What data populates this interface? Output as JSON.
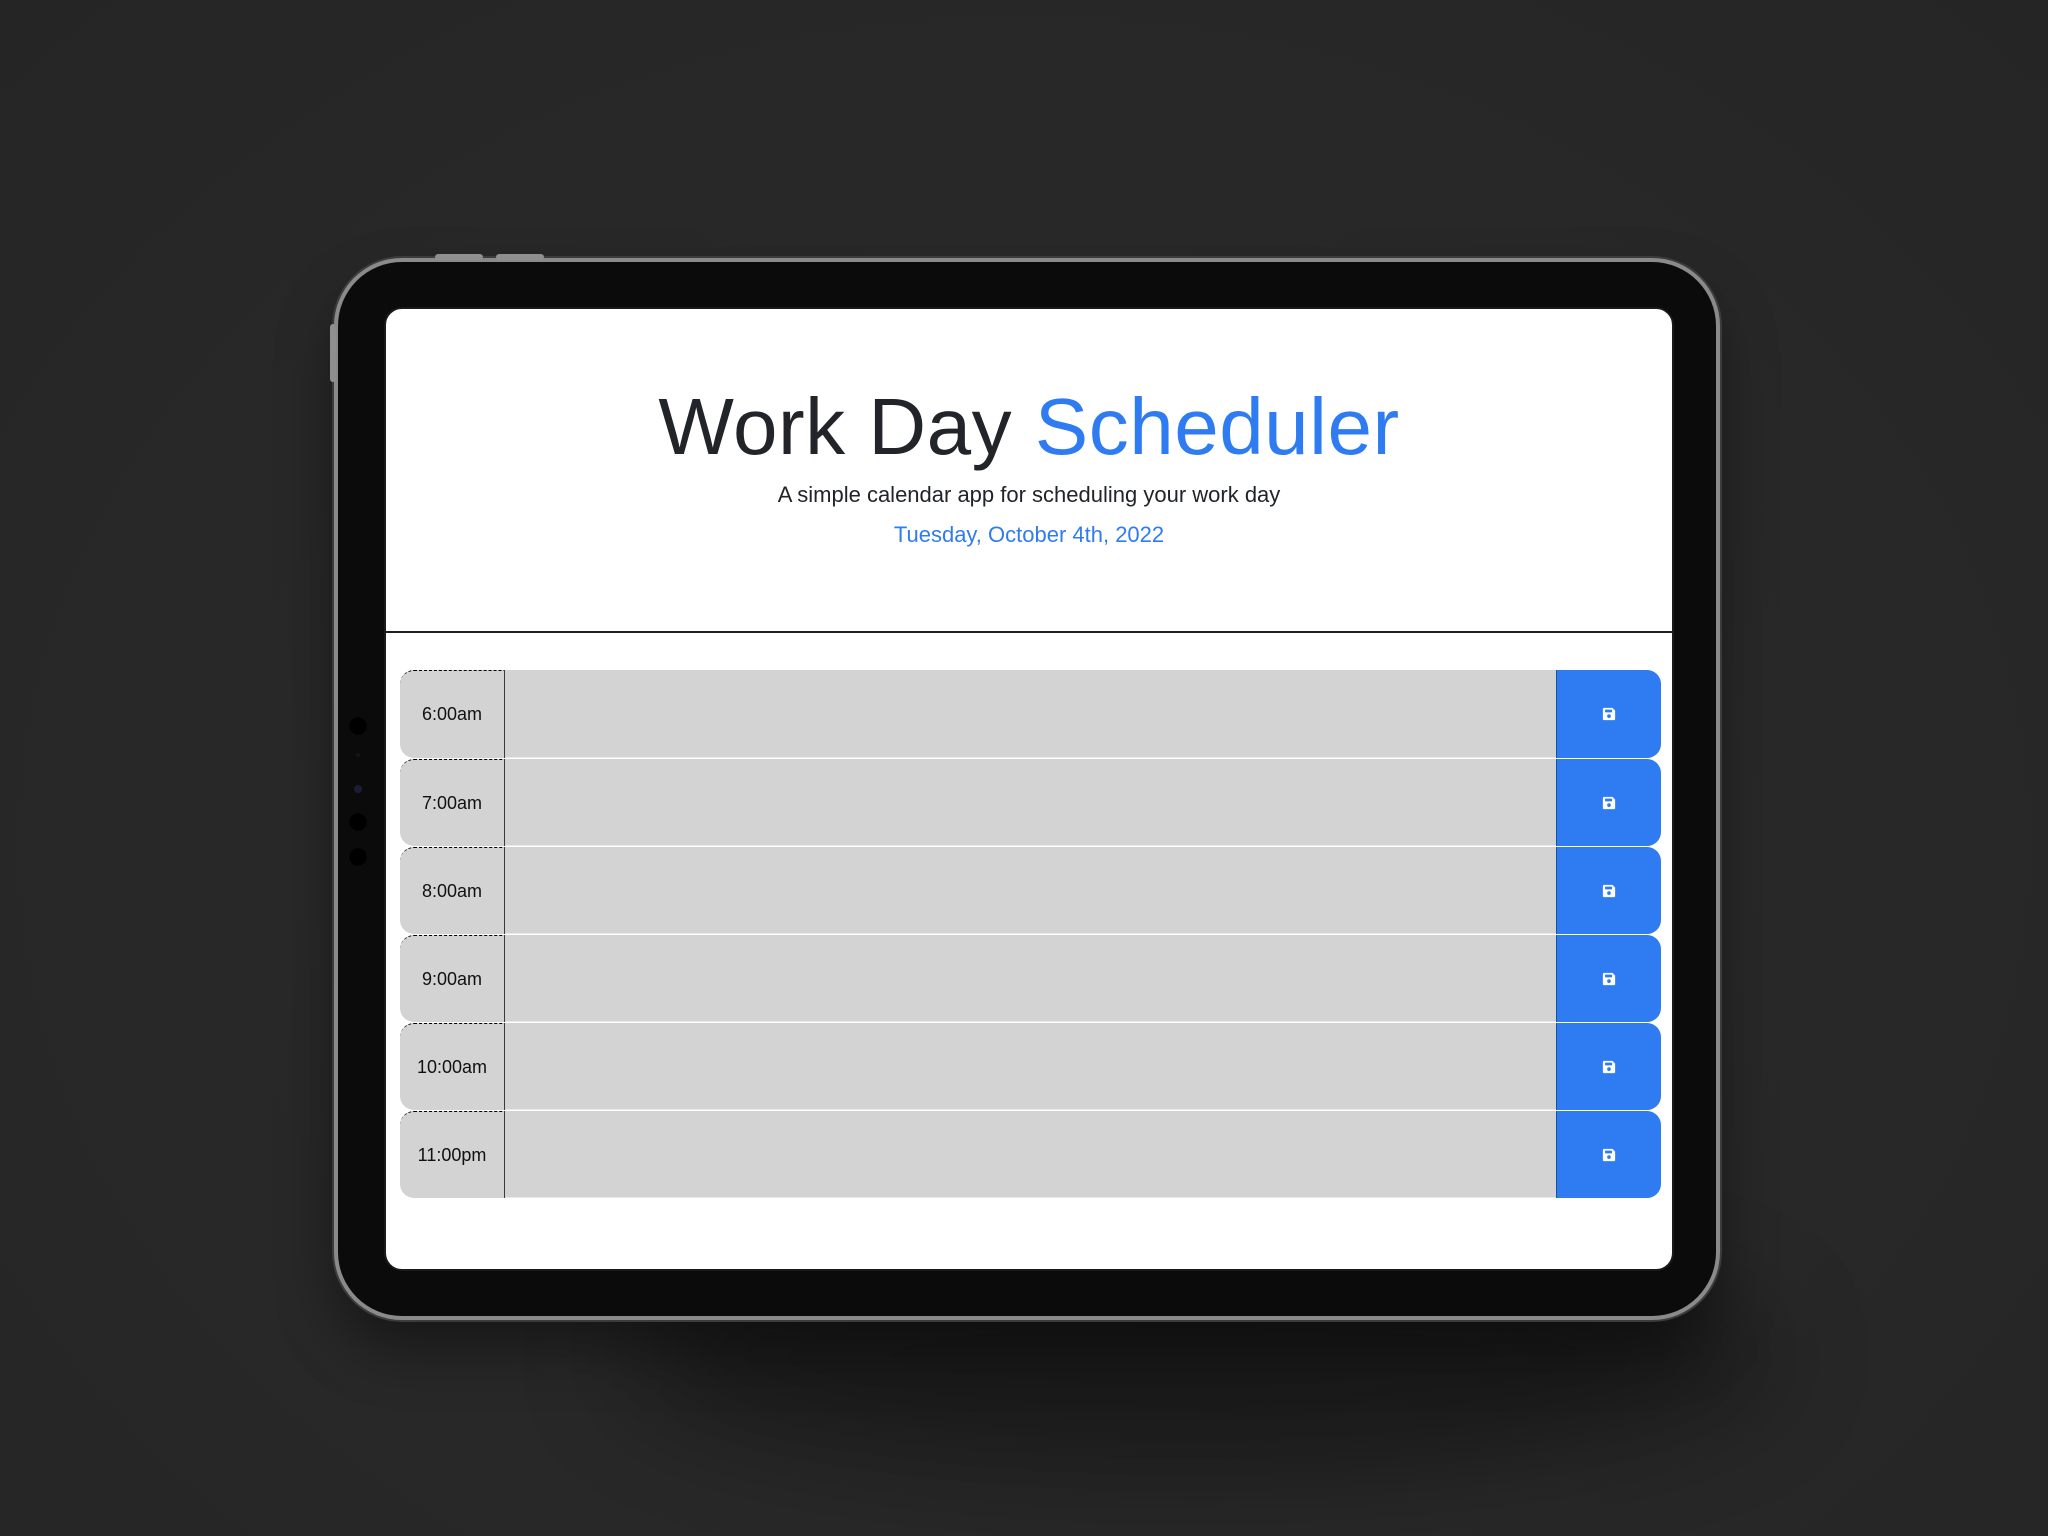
{
  "header": {
    "title_main": "Work Day",
    "title_accent": "Scheduler",
    "subtitle": "A simple calendar app for scheduling your work day",
    "current_date": "Tuesday, October 4th, 2022"
  },
  "schedule": {
    "rows": [
      {
        "hour": "6:00am",
        "text": ""
      },
      {
        "hour": "7:00am",
        "text": ""
      },
      {
        "hour": "8:00am",
        "text": ""
      },
      {
        "hour": "9:00am",
        "text": ""
      },
      {
        "hour": "10:00am",
        "text": ""
      },
      {
        "hour": "11:00pm",
        "text": ""
      }
    ],
    "save_icon": "floppy-disk-icon"
  },
  "colors": {
    "accent": "#2f7cf2",
    "row_background": "#d3d3d3",
    "text": "#212529",
    "backdrop": "#2a2a2a"
  }
}
